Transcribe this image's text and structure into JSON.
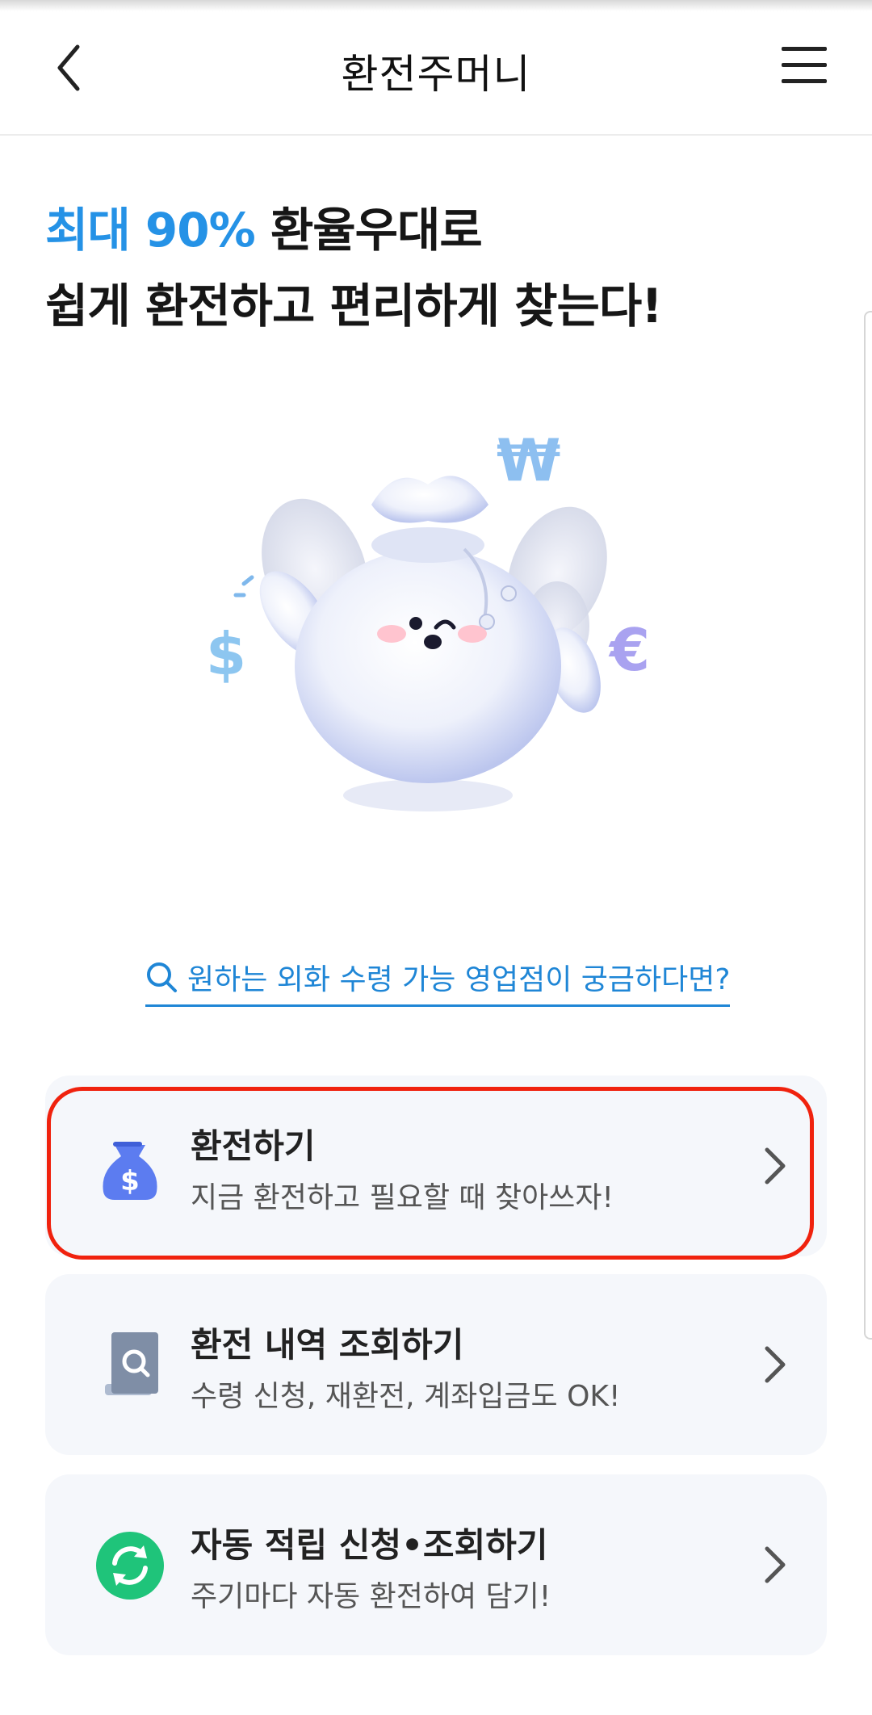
{
  "header": {
    "title": "환전주머니",
    "back_icon": "chevron-left-icon",
    "menu_icon": "hamburger-menu-icon"
  },
  "headline": {
    "accent": "최대 90%",
    "line1_rest": " 환율우대로",
    "line2": "쉽게 환전하고 편리하게 찾는다!"
  },
  "hero": {
    "illustration": "money-bag-mascot-with-currency-symbols"
  },
  "branch_link": {
    "text": "원하는 외화 수령 가능 영업점이 궁금하다면?",
    "icon": "search-icon"
  },
  "cards": [
    {
      "title": "환전하기",
      "subtitle": "지금 환전하고 필요할 때 찾아쓰자!",
      "icon": "money-bag-dollar-icon"
    },
    {
      "title": "환전 내역 조회하기",
      "subtitle": "수령 신청, 재환전, 계좌입금도 OK!",
      "icon": "receipt-search-icon"
    },
    {
      "title": "자동 적립 신청•조회하기",
      "subtitle": "주기마다 자동 환전하여 담기!",
      "icon": "auto-refresh-icon"
    }
  ],
  "colors": {
    "accent": "#2592e6",
    "link": "#1f86d6",
    "highlight_border": "#f0220e",
    "card_bg": "#f5f7fb",
    "green": "#1fc47a",
    "icon_blue": "#5c7cf0"
  }
}
